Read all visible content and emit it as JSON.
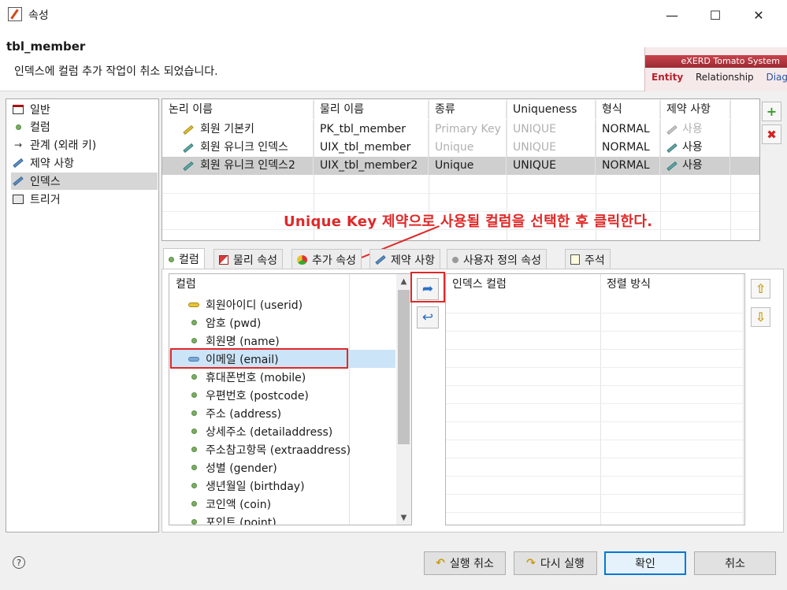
{
  "window": {
    "title": "속성",
    "minimize": "—",
    "maximize": "☐",
    "close": "✕"
  },
  "header": {
    "title": "tbl_member",
    "message": "인덱스에 컬럼 추가 작업이 취소 되었습니다.",
    "banner": {
      "brand": "eXERD  Tomato System",
      "tabs": [
        "Entity",
        "Relationship",
        "Diag"
      ]
    }
  },
  "sidebar": {
    "items": [
      {
        "label": "일반"
      },
      {
        "label": "컬럼"
      },
      {
        "label": "관계 (외래 키)"
      },
      {
        "label": "제약 사항"
      },
      {
        "label": "인덱스"
      },
      {
        "label": "트리거"
      }
    ]
  },
  "index_table": {
    "headers": [
      "논리 이름",
      "물리 이름",
      "종류",
      "Uniqueness",
      "형식",
      "제약 사항"
    ],
    "rows": [
      {
        "logical": "회원 기본키",
        "physical": "PK_tbl_member",
        "kind": "Primary Key",
        "uniqueness": "UNIQUE",
        "format": "NORMAL",
        "constraint": "사용"
      },
      {
        "logical": "회원 유니크 인덱스",
        "physical": "UIX_tbl_member",
        "kind": "Unique",
        "uniqueness": "UNIQUE",
        "format": "NORMAL",
        "constraint": "사용"
      },
      {
        "logical": "회원 유니크 인덱스2",
        "physical": "UIX_tbl_member2",
        "kind": "Unique",
        "uniqueness": "UNIQUE",
        "format": "NORMAL",
        "constraint": "사용"
      }
    ]
  },
  "annotation": "Unique Key 제약으로 사용될 컬럼을 선택한 후 클릭한다.",
  "tabs": [
    {
      "label": "컬럼"
    },
    {
      "label": "물리 속성"
    },
    {
      "label": "추가 속성"
    },
    {
      "label": "제약 사항"
    },
    {
      "label": "사용자 정의 속성"
    },
    {
      "label": "주석"
    }
  ],
  "columns": {
    "header": "컬럼",
    "items": [
      {
        "label": "회원아이디 (userid)"
      },
      {
        "label": "암호 (pwd)"
      },
      {
        "label": "회원명 (name)"
      },
      {
        "label": "이메일 (email)"
      },
      {
        "label": "휴대폰번호 (mobile)"
      },
      {
        "label": "우편번호 (postcode)"
      },
      {
        "label": "주소 (address)"
      },
      {
        "label": "상세주소 (detailaddress)"
      },
      {
        "label": "주소참고항목 (extraaddress)"
      },
      {
        "label": "성별 (gender)"
      },
      {
        "label": "생년월일 (birthday)"
      },
      {
        "label": "코인액 (coin)"
      },
      {
        "label": "포인트 (point)"
      }
    ]
  },
  "index_columns": {
    "headers": [
      "인덱스 컬럼",
      "정렬 방식"
    ]
  },
  "buttons": {
    "undo": "실행 취소",
    "redo": "다시 실행",
    "ok": "확인",
    "cancel": "취소",
    "help": "?",
    "add": "+",
    "delete": "✖",
    "move_right": "➦",
    "move_left": "↩",
    "move_up": "⇧",
    "move_down": "⇩",
    "scroll_up": "▲",
    "scroll_down": "▼"
  }
}
